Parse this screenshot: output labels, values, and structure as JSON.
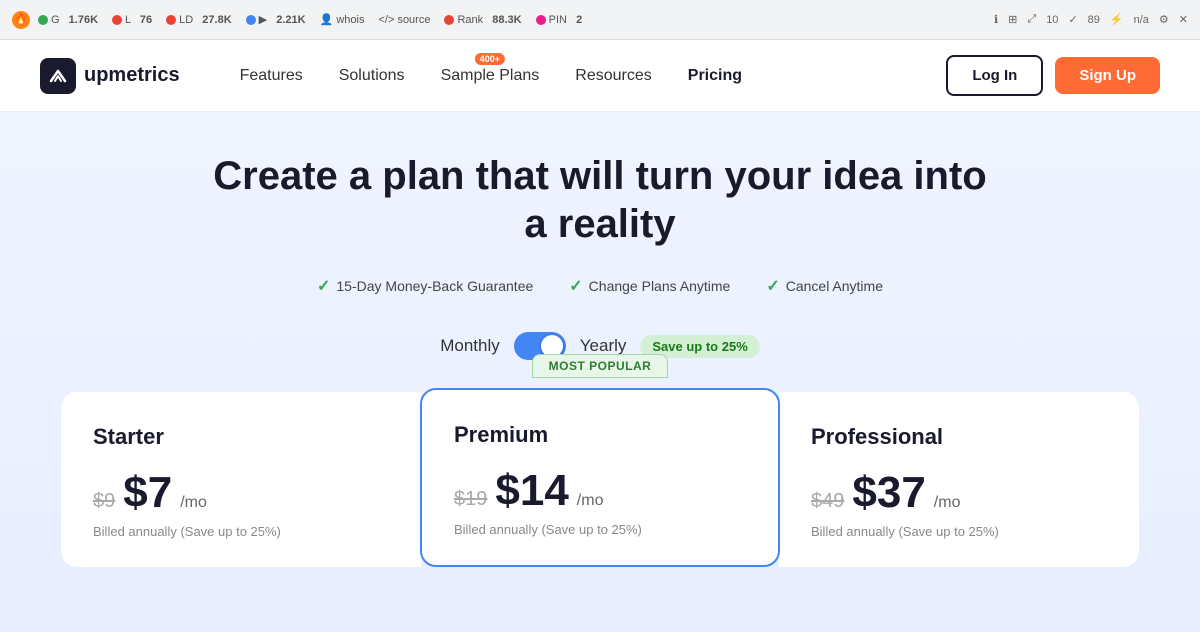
{
  "browser": {
    "metrics": [
      {
        "icon": "flame",
        "label": "1.76K",
        "color": "#ff6b35"
      },
      {
        "prefix": "G",
        "label": "1.76K",
        "dot": "green"
      },
      {
        "prefix": "L",
        "label": "76",
        "dot": "orange"
      },
      {
        "prefix": "LD",
        "label": "27.8K",
        "dot": "orange"
      },
      {
        "prefix": "▶",
        "label": "2.21K",
        "dot": "blue"
      },
      {
        "prefix": "whois",
        "dot": "person"
      },
      {
        "prefix": "source",
        "dot": "code"
      },
      {
        "prefix": "Rank",
        "label": "88.3K",
        "dot": "orange"
      },
      {
        "prefix": "PIN",
        "label": "2",
        "dot": "pink"
      }
    ],
    "icon_counts": [
      "10",
      "89",
      "n/a"
    ]
  },
  "nav": {
    "logo_text": "upmetrics",
    "links": [
      {
        "label": "Features",
        "active": false
      },
      {
        "label": "Solutions",
        "active": false
      },
      {
        "label": "Sample Plans",
        "active": false,
        "badge": "400+"
      },
      {
        "label": "Resources",
        "active": false
      },
      {
        "label": "Pricing",
        "active": true
      }
    ],
    "login_label": "Log In",
    "signup_label": "Sign Up"
  },
  "hero": {
    "title": "Create a plan that will turn your idea into a reality",
    "guarantees": [
      "15-Day Money-Back Guarantee",
      "Change Plans Anytime",
      "Cancel Anytime"
    ]
  },
  "billing_toggle": {
    "monthly_label": "Monthly",
    "yearly_label": "Yearly",
    "save_label": "Save up to 25%",
    "active": "yearly"
  },
  "plans": [
    {
      "name": "Starter",
      "original_price": "$9",
      "current_price": "$7",
      "period": "/mo",
      "billed_note": "Billed annually (Save up to 25%)",
      "popular": false,
      "card_type": "starter"
    },
    {
      "name": "Premium",
      "original_price": "$19",
      "current_price": "$14",
      "period": "/mo",
      "billed_note": "Billed annually (Save up to 25%)",
      "popular": true,
      "popular_label": "MOST POPULAR",
      "card_type": "premium"
    },
    {
      "name": "Professional",
      "original_price": "$49",
      "current_price": "$37",
      "period": "/mo",
      "billed_note": "Billed annually (Save up to 25%)",
      "popular": false,
      "card_type": "professional"
    }
  ]
}
